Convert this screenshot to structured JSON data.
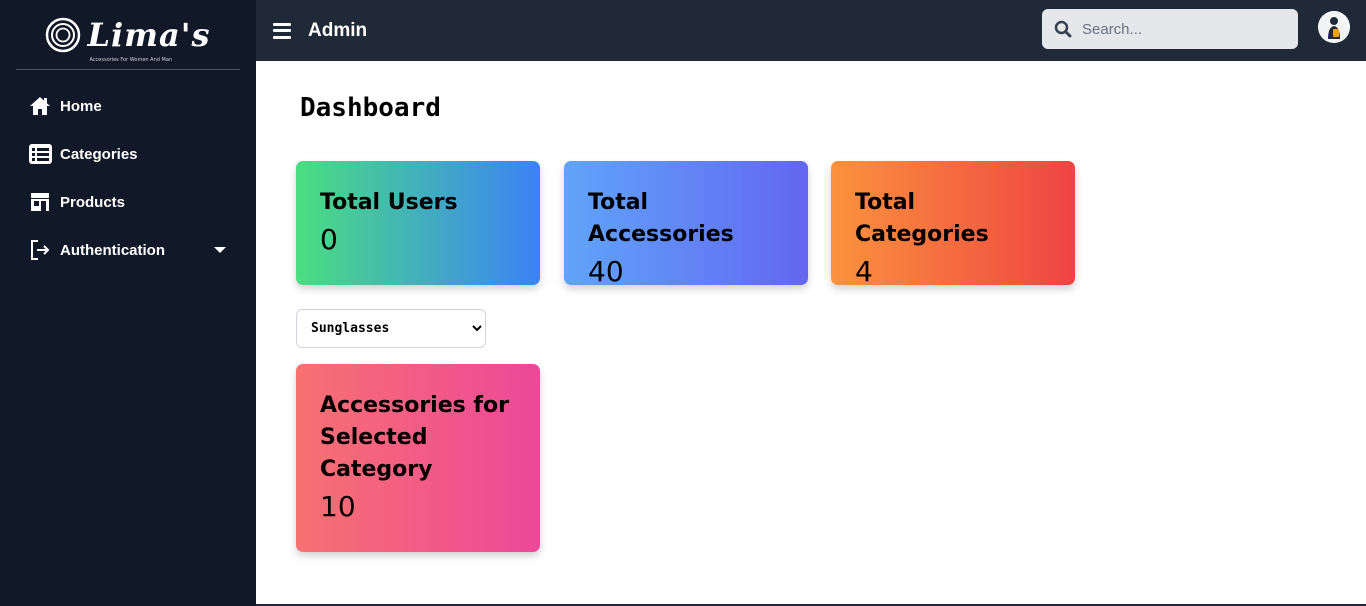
{
  "brand": {
    "name": "Lima's",
    "tagline": "Accessories For Women And Man"
  },
  "sidebar": {
    "items": [
      {
        "label": "Home",
        "icon": "home-icon"
      },
      {
        "label": "Categories",
        "icon": "list-icon"
      },
      {
        "label": "Products",
        "icon": "store-icon"
      },
      {
        "label": "Authentication",
        "icon": "sign-out-icon",
        "has_dropdown": true
      }
    ]
  },
  "topbar": {
    "title": "Admin",
    "search_placeholder": "Search..."
  },
  "main": {
    "page_title": "Dashboard",
    "cards": [
      {
        "title": "Total Users",
        "value": "0"
      },
      {
        "title": "Total Accessories",
        "value": "40"
      },
      {
        "title": "Total Categories",
        "value": "4"
      }
    ],
    "category_select": {
      "selected": "Sunglasses"
    },
    "selected_card": {
      "title": "Accessories for Selected Category",
      "value": "10"
    }
  },
  "colors": {
    "sidebar_bg": "#111827",
    "topbar_bg": "#1f2937",
    "users_gradient": [
      "#4ade80",
      "#3b82f6"
    ],
    "accessories_gradient": [
      "#60a5fa",
      "#6366f1"
    ],
    "categories_gradient": [
      "#fb923c",
      "#ef4444"
    ],
    "selected_gradient": [
      "#f87171",
      "#ec4899"
    ]
  }
}
